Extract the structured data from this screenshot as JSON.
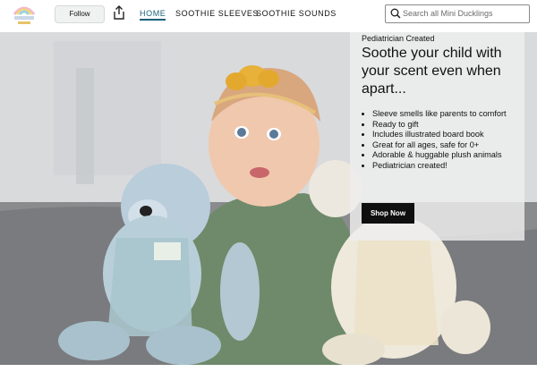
{
  "header": {
    "follow_label": "Follow",
    "share_icon": "share-icon",
    "nav": [
      {
        "label": "HOME",
        "active": true
      },
      {
        "label": "SOOTHIE SLEEVES",
        "active": false
      },
      {
        "label": "SOOTHIE SOUNDS",
        "active": false
      }
    ],
    "search": {
      "placeholder": "Search all Mini Ducklings",
      "value": "",
      "icon": "search-icon"
    }
  },
  "hero": {
    "eyebrow": "Pediatrician Created",
    "headline": "Soothe your child with your scent even when apart...",
    "bullets": [
      "Sleeve smells like parents to comfort",
      "Ready to gift",
      "Includes illustrated board book",
      "Great for all ages, safe for 0+",
      "Adorable & huggable plush animals",
      "Pediatrician created!"
    ],
    "cta_label": "Shop Now"
  },
  "colors": {
    "nav_active": "#1a5f7a",
    "cta_bg": "#0f0f0f"
  }
}
